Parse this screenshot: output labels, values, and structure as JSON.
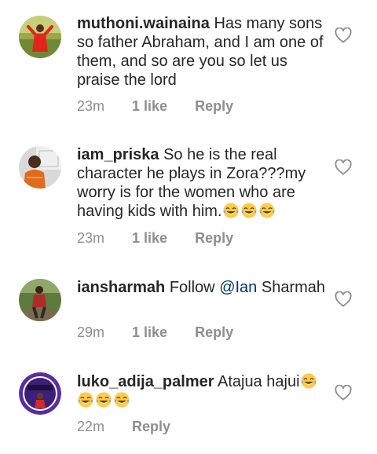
{
  "comments": [
    {
      "username": "muthoni.wainaina",
      "text": "Has many sons so father Abraham, and I am one of them, and so are you so let us praise the lord",
      "time": "23m",
      "likes": "1 like",
      "reply": "Reply"
    },
    {
      "username": "iam_priska",
      "text": "So he is the real character he plays in Zora???my worry is for the women who are having kids with him.",
      "emoji_count": 3,
      "time": "23m",
      "likes": "1 like",
      "reply": "Reply"
    },
    {
      "username": "iansharmah",
      "text_before": "Follow ",
      "mention": "@Ian",
      "text_after": "Sharmah",
      "time": "29m",
      "likes": "1 like",
      "reply": "Reply"
    },
    {
      "username": "luko_adija_palmer",
      "text": "Atajua hajui",
      "emoji_count": 4,
      "time": "22m",
      "reply": "Reply"
    }
  ],
  "icons": {
    "like": "heart-outline-icon",
    "emoji": "tears-of-joy-emoji"
  },
  "colors": {
    "text": "#262626",
    "meta": "#8e8e8e",
    "mention": "#00376b",
    "avatar_ring": "#5b2ca0"
  }
}
